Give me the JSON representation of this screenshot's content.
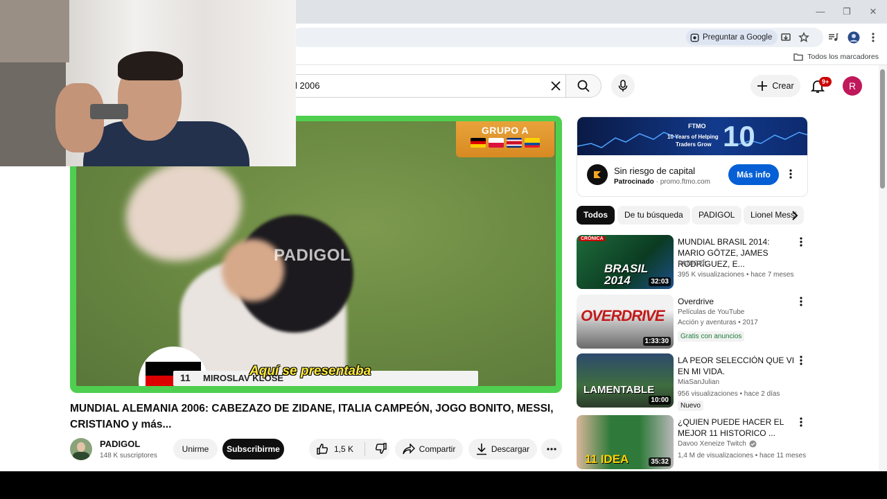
{
  "browser": {
    "ask_google": "Preguntar a Google",
    "all_bookmarks": "Todos los marcadores"
  },
  "yt_header": {
    "search_value": "l 2006",
    "create_label": "Crear",
    "notif_count": "9+",
    "avatar_letter": "R"
  },
  "video": {
    "watermark": "PADIGOL",
    "group_label": "GRUPO A",
    "player_number": "11",
    "player_name": "MIROSLAV KLOSE",
    "subtitle": "Aquí se presentaba"
  },
  "meta": {
    "title": "MUNDIAL ALEMANIA 2006: CABEZAZO DE ZIDANE, ITALIA CAMPEÓN, JOGO BONITO, MESSI, CRISTIANO y más...",
    "channel": "PADIGOL",
    "subscribers": "148 K suscriptores",
    "join": "Unirme",
    "subscribe": "Subscribirme",
    "likes": "1,5 K",
    "share": "Compartir",
    "download": "Descargar"
  },
  "ad": {
    "banner_brand": "FTMO",
    "banner_line1": "10 Years of Helping",
    "banner_line2": "Traders Grow",
    "banner_big": "10",
    "title": "Sin riesgo de capital",
    "sponsored": "Patrocinado",
    "domain": "promo.ftmo.com",
    "cta": "Más info"
  },
  "chips": [
    "Todos",
    "De tu búsqueda",
    "PADIGOL",
    "Lionel Messi"
  ],
  "recommendations": [
    {
      "title": "MUNDIAL BRASIL 2014: MARIO GÖTZE, JAMES RODRÍGUEZ, E...",
      "channel": "PADIGOL",
      "meta": "395 K visualizaciones • hace 7 meses",
      "duration": "32:03",
      "thumb_text": "BRASIL 2014",
      "thumb_top": "CRÓNICA"
    },
    {
      "title": "Overdrive",
      "channel": "Películas de YouTube",
      "meta": "Acción y aventuras • 2017",
      "duration": "1:33:30",
      "thumb_text": "OVERDRIVE",
      "badge": "Gratis con anuncios"
    },
    {
      "title": "LA PEOR SELECCIÓN QUE VI EN MI VIDA.",
      "channel": "MiaSanJulian",
      "meta": "956 visualizaciones • hace 2 días",
      "duration": "10:00",
      "thumb_text": "LAMENTABLE",
      "badge": "Nuevo"
    },
    {
      "title": "¿QUIEN PUEDE HACER EL MEJOR 11 HISTORICO ...",
      "channel": "Davoo Xeneize Twitch",
      "meta": "1,4 M de visualizaciones • hace 11 meses",
      "duration": "35:32",
      "thumb_text": "11 IDEA"
    }
  ],
  "colors": {
    "subscribe_bg": "#0f0f0f",
    "ad_cta": "#065fd4",
    "player_border": "#4fcf4f",
    "notif_badge": "#cc0000"
  }
}
